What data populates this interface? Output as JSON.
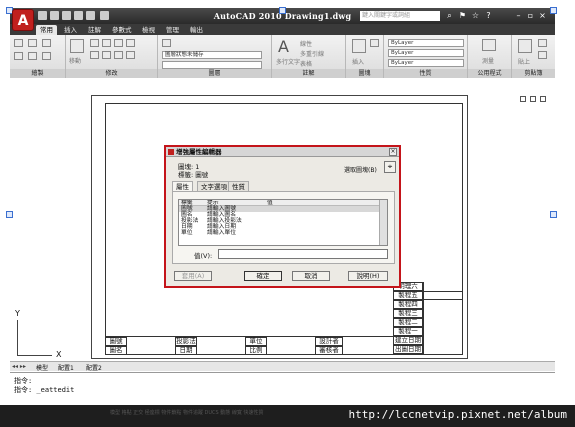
{
  "title_bar": {
    "app_title": "AutoCAD 2010   Drawing1.dwg",
    "search_placeholder": "鍵入關鍵字或詞組",
    "logo": "A"
  },
  "ribbon_tabs": [
    "常用",
    "插入",
    "註解",
    "參數式",
    "檢視",
    "管理",
    "輸出"
  ],
  "ribbon_panels": {
    "draw": "繪製",
    "modify": "修改",
    "modify_move": "移動",
    "layers": "圖層",
    "layer_state": "圖層狀態未儲存",
    "annotation": "註解",
    "annotation_text": "多行文字",
    "annotation_linear": "線性",
    "annotation_multileader": "多重引線",
    "annotation_table": "表格",
    "block": "圖塊",
    "block_insert": "插入",
    "properties": "性質",
    "bylayer": "ByLayer",
    "utilities": "公用程式",
    "utilities_measure": "測量",
    "clipboard": "剪貼簿",
    "clipboard_paste": "貼上"
  },
  "drawing": {
    "title_block_right": [
      "明理六",
      "製程五",
      "製程四",
      "製程三",
      "製程二",
      "製程一",
      "建立日期",
      "出圖日期"
    ],
    "title_block_row1": [
      "圖號",
      "投影法",
      "單位",
      "設計者"
    ],
    "title_block_row2": [
      "圖名",
      "日期",
      "比例",
      "審核者"
    ],
    "ucs_x": "X",
    "ucs_y": "Y"
  },
  "dialog": {
    "title": "增強屬性編輯器",
    "block_label": "圖塊: 1",
    "tag_label": "標籤: 圖號",
    "select_block": "選取圖塊(B)",
    "tabs": [
      "屬性",
      "文字選項",
      "性質"
    ],
    "columns": [
      "標籤",
      "提示",
      "值"
    ],
    "rows": [
      [
        "圖號",
        "請輸入圖號",
        ""
      ],
      [
        "圖名",
        "請輸入圖名",
        ""
      ],
      [
        "投影法",
        "請輸入投影法",
        ""
      ],
      [
        "日期",
        "請輸入日期",
        ""
      ],
      [
        "單位",
        "請輸入單位",
        ""
      ]
    ],
    "value_label": "值(V):",
    "buttons": {
      "apply": "套用(A)",
      "ok": "確定",
      "cancel": "取消",
      "help": "說明(H)"
    }
  },
  "layout_tabs": [
    "模型",
    "配置1",
    "配置2"
  ],
  "command": {
    "line1": "指令:",
    "line2": "指令: _eattedit"
  },
  "status_bar": {
    "text": "模型 格點 正交 極座標 物件鎖點 物件追蹤 DUCS 動態 線寬 快速性質",
    "watermark": "http://lccnetvip.pixnet.net/album"
  }
}
